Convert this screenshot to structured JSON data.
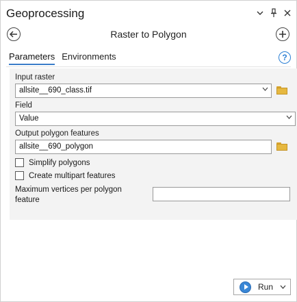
{
  "pane": {
    "title": "Geoprocessing",
    "icons": [
      "chevron-down-icon",
      "pin-icon",
      "close-icon"
    ]
  },
  "tool": {
    "title": "Raster to Polygon"
  },
  "tabs": [
    {
      "label": "Parameters",
      "active": true
    },
    {
      "label": "Environments",
      "active": false
    }
  ],
  "params": {
    "input_raster": {
      "label": "Input raster",
      "value": "allsite__690_class.tif"
    },
    "field": {
      "label": "Field",
      "value": "Value"
    },
    "output": {
      "label": "Output polygon features",
      "value": "allsite__690_polygon"
    },
    "simplify": {
      "label": "Simplify polygons",
      "checked": false
    },
    "multipart": {
      "label": "Create multipart features",
      "checked": false
    },
    "max_vertices": {
      "label": "Maximum vertices per polygon feature",
      "value": ""
    }
  },
  "run": {
    "label": "Run"
  },
  "colors": {
    "accent": "#3a7dc9",
    "run_icon": "#3a87d6",
    "folder": "#e6b840"
  }
}
